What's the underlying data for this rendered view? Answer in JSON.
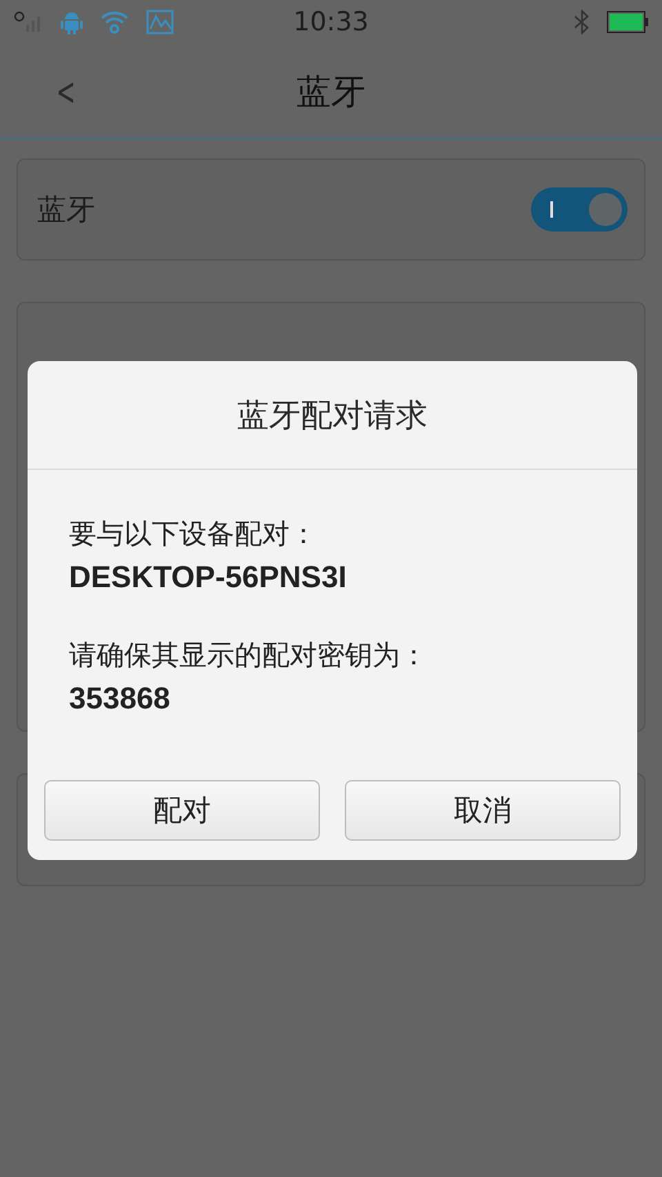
{
  "status_bar": {
    "time": "10:33",
    "bluetooth": true
  },
  "header": {
    "back": "<",
    "title": "蓝牙"
  },
  "bluetooth_row": {
    "label": "蓝牙",
    "on": true
  },
  "dialog": {
    "title": "蓝牙配对请求",
    "lines": [
      {
        "text": "要与以下设备配对：",
        "kind": "plain"
      },
      {
        "text": "DESKTOP-56PNS3I",
        "kind": "strong"
      },
      {
        "text": "请确保其显示的配对密钥为：",
        "kind": "plain"
      },
      {
        "text": "353868",
        "kind": "strong"
      }
    ],
    "buttons": [
      "配对",
      "取消"
    ]
  }
}
